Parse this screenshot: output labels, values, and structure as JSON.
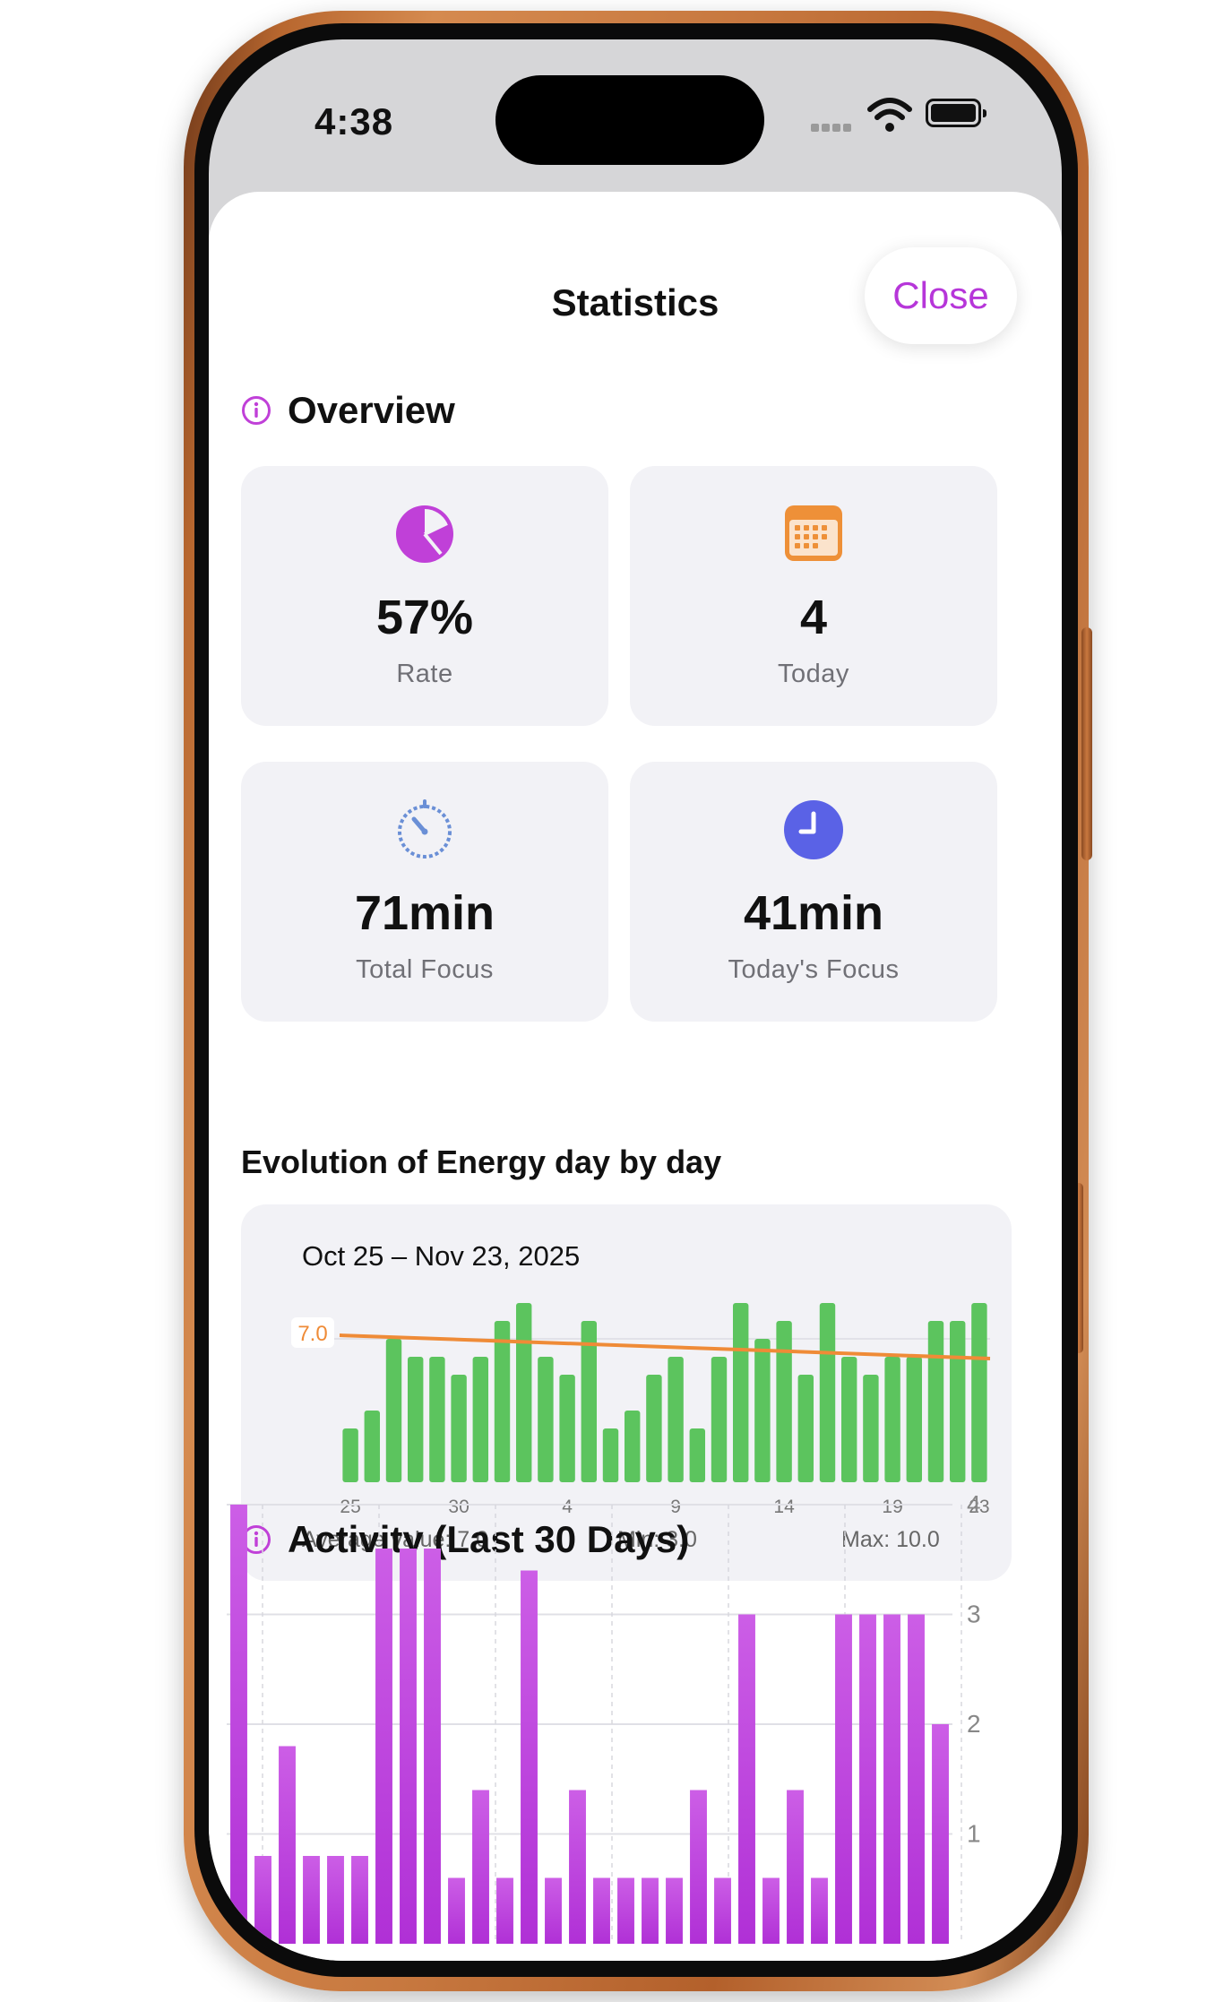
{
  "status_bar": {
    "time": "4:38"
  },
  "sheet": {
    "title": "Statistics",
    "close_label": "Close"
  },
  "overview": {
    "heading": "Overview",
    "cards": [
      {
        "icon": "pie-chart-icon",
        "value": "57%",
        "label": "Rate",
        "color": "#c040d8"
      },
      {
        "icon": "calendar-icon",
        "value": "4",
        "label": "Today",
        "color": "#ee9038"
      },
      {
        "icon": "timer-icon",
        "value": "71min",
        "label": "Total Focus",
        "color": "#6a8fd6"
      },
      {
        "icon": "clock-icon",
        "value": "41min",
        "label": "Today's Focus",
        "color": "#5a62e6"
      }
    ]
  },
  "energy": {
    "heading": "Evolution of Energy day by day",
    "date_range": "Oct 25 – Nov 23, 2025",
    "average_badge": "7.0",
    "footer": {
      "average": "Average value: 7.0",
      "min": "Min: 3.0",
      "max": "Max: 10.0"
    }
  },
  "activity": {
    "heading": "Activity (Last 30 Days)"
  },
  "chart_data": [
    {
      "type": "bar",
      "x": [
        25,
        26,
        27,
        28,
        29,
        30,
        31,
        1,
        2,
        3,
        4,
        5,
        6,
        7,
        8,
        9,
        10,
        11,
        12,
        13,
        14,
        15,
        16,
        17,
        18,
        19,
        20,
        21,
        22,
        23
      ],
      "values": [
        3,
        4,
        8,
        7,
        7,
        6,
        7,
        9,
        10,
        7,
        6,
        9,
        3,
        4,
        6,
        7,
        3,
        7,
        10,
        8,
        9,
        6,
        10,
        7,
        6,
        7,
        7,
        9,
        9,
        10
      ],
      "xticks": [
        "25",
        "30",
        "4",
        "9",
        "14",
        "19",
        "23"
      ],
      "average_line": 7.0,
      "bar_color": "#5cc45e",
      "line_color": "#ef8b37"
    },
    {
      "type": "bar",
      "values": [
        4.0,
        0.8,
        1.8,
        0.8,
        0.8,
        0.8,
        3.6,
        3.6,
        3.6,
        0.6,
        1.4,
        0.6,
        3.4,
        0.6,
        1.4,
        0.6,
        0.6,
        0.6,
        0.6,
        1.4,
        0.6,
        3.0,
        0.6,
        1.4,
        0.6,
        3.0,
        3.0,
        3.0,
        3.0,
        2.0
      ],
      "yticks": [
        "1",
        "2",
        "3",
        "4"
      ],
      "ylim": [
        0,
        4
      ],
      "bar_color": "#c24ae0"
    }
  ]
}
